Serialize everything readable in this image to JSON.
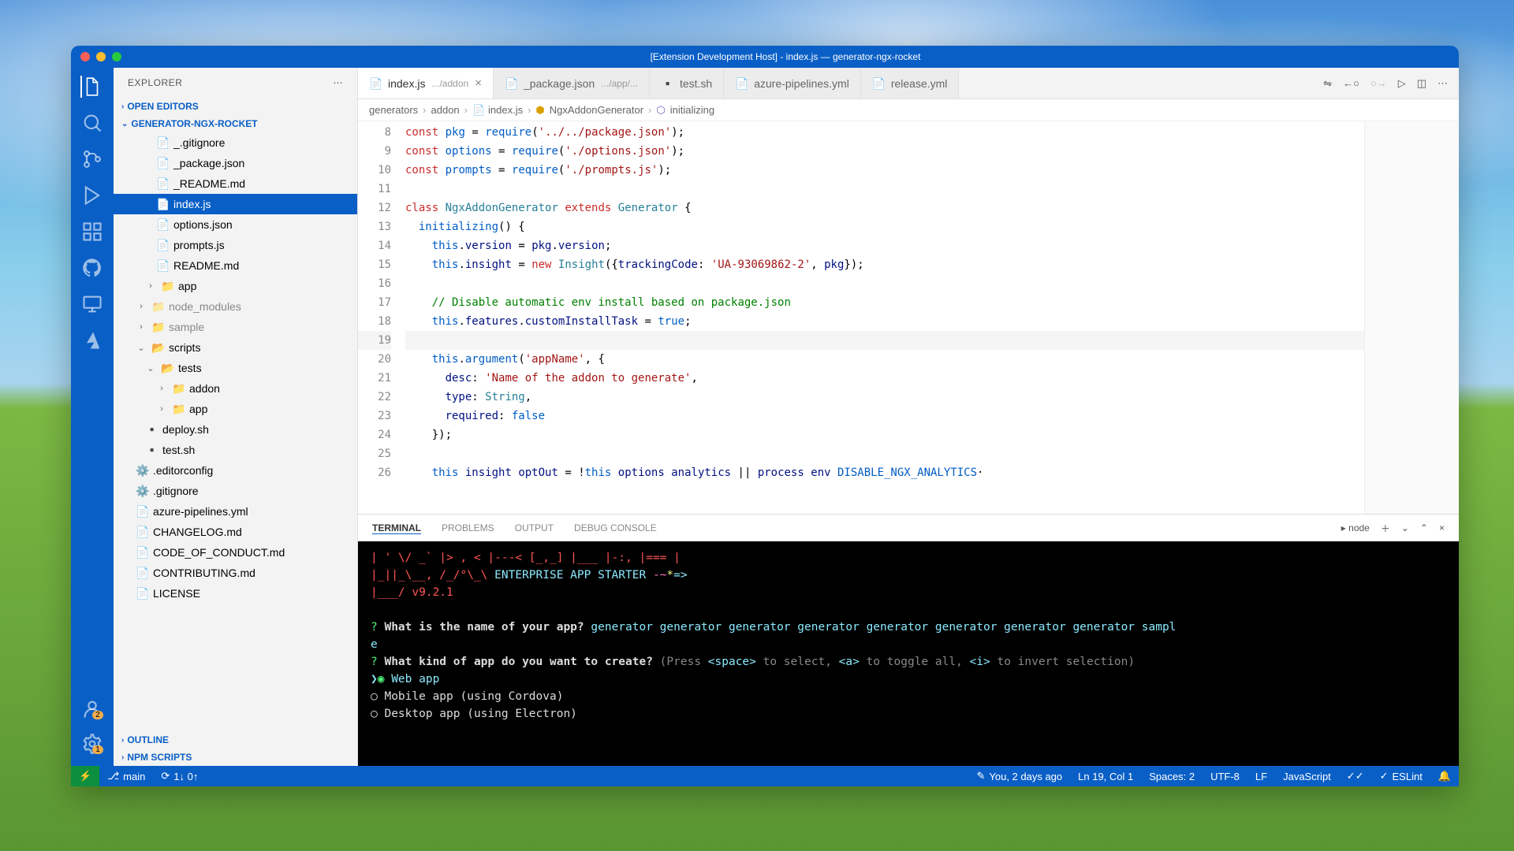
{
  "window_title": "[Extension Development Host] - index.js — generator-ngx-rocket",
  "explorer": {
    "title": "EXPLORER",
    "open_editors": "OPEN EDITORS",
    "project": "GENERATOR-NGX-ROCKET",
    "outline": "OUTLINE",
    "npm_scripts": "NPM SCRIPTS",
    "files": {
      "gitignore": "_.gitignore",
      "package": "_package.json",
      "readme_u": "_README.md",
      "index": "index.js",
      "options": "options.json",
      "prompts": "prompts.js",
      "readme": "README.md",
      "app": "app",
      "node_modules": "node_modules",
      "sample": "sample",
      "scripts": "scripts",
      "tests": "tests",
      "addon_f": "addon",
      "app_f": "app",
      "deploy": "deploy.sh",
      "test": "test.sh",
      "editorconfig": ".editorconfig",
      "gitignore2": ".gitignore",
      "azure": "azure-pipelines.yml",
      "changelog": "CHANGELOG.md",
      "coc": "CODE_OF_CONDUCT.md",
      "contrib": "CONTRIBUTING.md",
      "license": "LICENSE"
    }
  },
  "tabs": [
    {
      "name": "index.js",
      "hint": ".../addon",
      "active": true
    },
    {
      "name": "_package.json",
      "hint": ".../app/..."
    },
    {
      "name": "test.sh",
      "hint": ""
    },
    {
      "name": "azure-pipelines.yml",
      "hint": ""
    },
    {
      "name": "release.yml",
      "hint": ""
    }
  ],
  "breadcrumb": [
    "generators",
    "addon",
    "index.js",
    "NgxAddonGenerator",
    "initializing"
  ],
  "editor": {
    "lines": [
      8,
      9,
      10,
      11,
      12,
      13,
      14,
      15,
      16,
      17,
      18,
      19,
      20,
      21,
      22,
      23,
      24,
      25,
      26
    ]
  },
  "panel": {
    "tabs": [
      "TERMINAL",
      "PROBLEMS",
      "OUTPUT",
      "DEBUG CONSOLE"
    ],
    "shell": "node"
  },
  "terminal": {
    "banner1": "| ' \\/ _` |> , <  |---< [_,_] |___  |-:,  |===  |",
    "banner2": "|_||_\\__, /_/°\\_\\ ENTERPRISE APP STARTER -~*=>",
    "banner3": "     |___/ v9.2.1",
    "q1": "What is the name of your app?",
    "a1": "generator generator generator generator generator generator generator generator sampl",
    "a1b": "e",
    "q2": "What kind of app do you want to create?",
    "q2hint": "(Press <space> to select, <a> to toggle all, <i> to invert selection)",
    "opt1": "Web app",
    "opt2": "Mobile app (using Cordova)",
    "opt3": "Desktop app (using Electron)"
  },
  "status": {
    "branch": "main",
    "sync": "1↓ 0↑",
    "blame": "You, 2 days ago",
    "pos": "Ln 19, Col 1",
    "spaces": "Spaces: 2",
    "encoding": "UTF-8",
    "eol": "LF",
    "lang": "JavaScript",
    "eslint": "ESLint"
  }
}
